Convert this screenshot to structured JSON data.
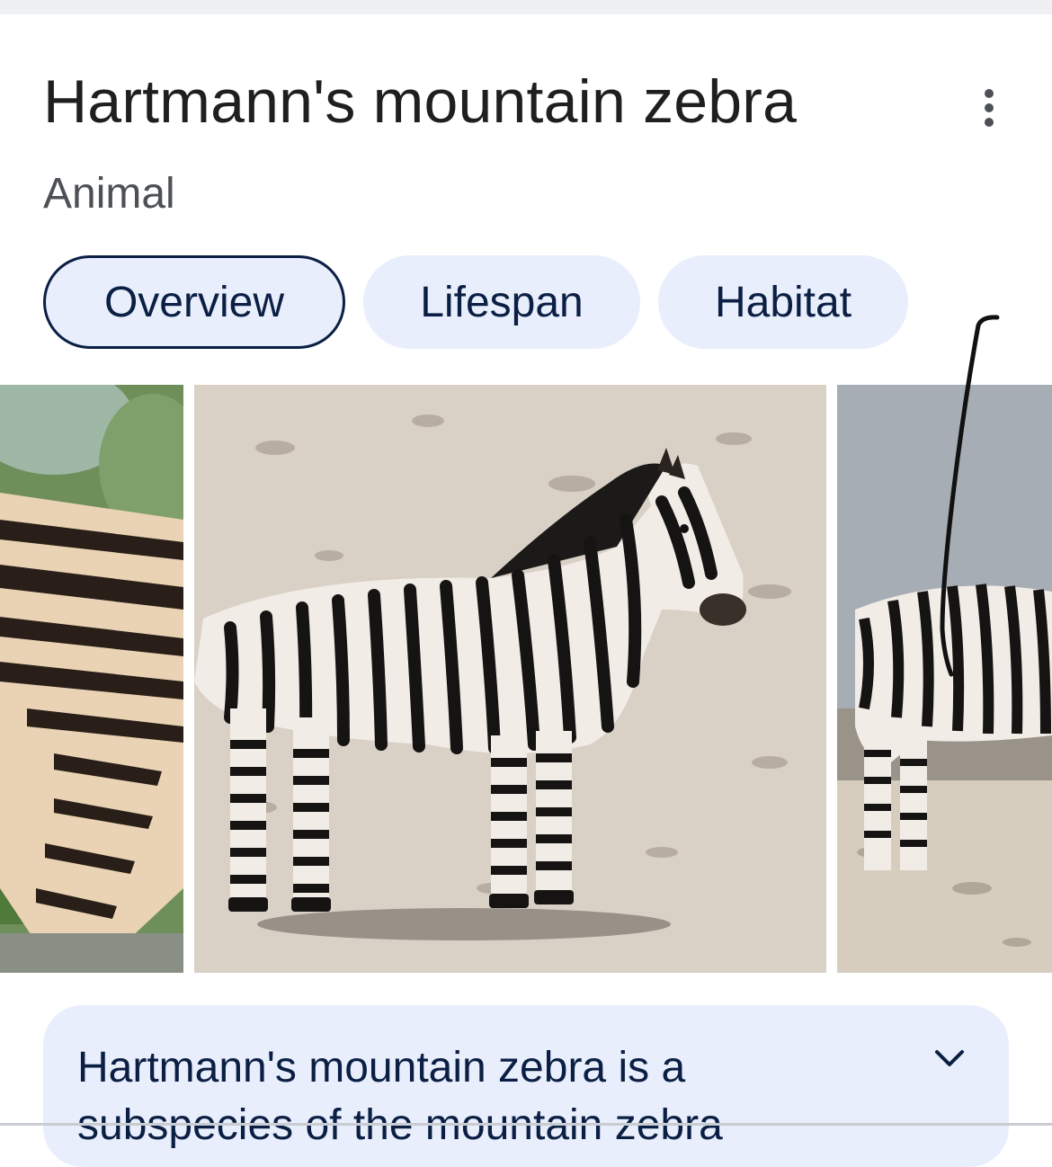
{
  "header": {
    "title": "Hartmann's mountain zebra",
    "subtitle": "Animal",
    "more_icon": "more-vert-icon"
  },
  "tabs": [
    {
      "label": "Overview",
      "active": true
    },
    {
      "label": "Lifespan",
      "active": false
    },
    {
      "label": "Habitat",
      "active": false
    }
  ],
  "gallery": {
    "image_count_visible": 3
  },
  "description": {
    "text": "Hartmann's mountain zebra is a subspecies of the mountain zebra",
    "expand_icon": "chevron-down-icon"
  },
  "colors": {
    "chip_bg": "#e8eefb",
    "chip_text": "#0b1f44",
    "title_text": "#1f1f1f",
    "subtitle_text": "#4d5156"
  }
}
